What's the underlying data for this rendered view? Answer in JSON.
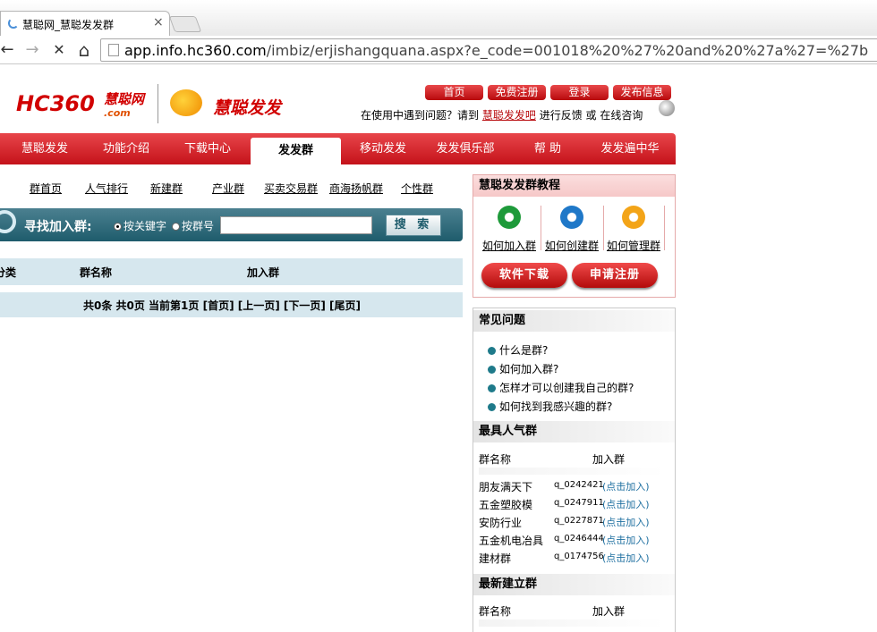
{
  "browser": {
    "tab_title": "慧聪网_慧聪发发群",
    "tab_close": "×",
    "back_icon": "←",
    "forward_icon": "→",
    "stop_icon": "✕",
    "home_icon": "⌂",
    "url_domain": "app.info.hc360.com",
    "url_path": "/imbiz/erjishangquana.aspx?e_code=001018%20%27%20and%20%27a%27=%27b"
  },
  "header": {
    "logo_hc": "HC360",
    "logo_hc_cn": "慧聪网",
    "logo_com": ".com",
    "logo_ff": "慧聪发发",
    "top_links": [
      "首页",
      "免费注册",
      "登录",
      "发布信息"
    ],
    "help_prefix": "在使用中遇到问题？请到",
    "help_link": "慧聪发发吧",
    "help_middle": "进行反馈 或",
    "help_suffix": "在线咨询"
  },
  "main_nav": [
    "慧聪发发",
    "功能介绍",
    "下载中心",
    "发发群",
    "移动发发",
    "发发俱乐部",
    "帮 助",
    "发发遍中华"
  ],
  "sub_nav": [
    "群首页",
    "人气排行",
    "新建群",
    "产业群",
    "买卖交易群",
    "商海扬帆群",
    "个性群"
  ],
  "search": {
    "label": "寻找加入群:",
    "radio_keyword": "按关键字",
    "radio_number": "按群号",
    "input_value": "",
    "button": "搜 索"
  },
  "table": {
    "headers": [
      "分类",
      "群名称",
      "加入群"
    ],
    "pager": "共0条 共0页 当前第1页 [首页] [上一页] [下一页] [尾页]"
  },
  "tutorial": {
    "title": "慧聪发发群教程",
    "items": [
      "如何加入群",
      "如何创建群",
      "如何管理群"
    ],
    "buttons": [
      "软件下载",
      "申请注册"
    ]
  },
  "faq": {
    "title": "常见问题",
    "items": [
      "什么是群?",
      "如何加入群?",
      "怎样才可以创建我自己的群?",
      "如何找到我感兴趣的群?"
    ]
  },
  "popular": {
    "title": "最具人气群",
    "col_name": "群名称",
    "col_join": "加入群",
    "rows": [
      {
        "name": "朋友满天下",
        "id": "q_0242421",
        "join": "(点击加入)"
      },
      {
        "name": "五金塑胶模",
        "id": "q_0247911",
        "join": "(点击加入)"
      },
      {
        "name": "安防行业",
        "id": "q_0227871",
        "join": "(点击加入)"
      },
      {
        "name": "五金机电冶具",
        "id": "q_0246444",
        "join": "(点击加入)"
      },
      {
        "name": "建材群",
        "id": "q_0174756",
        "join": "(点击加入)"
      }
    ]
  },
  "newest": {
    "title": "最新建立群",
    "col_name": "群名称",
    "col_join": "加入群"
  }
}
